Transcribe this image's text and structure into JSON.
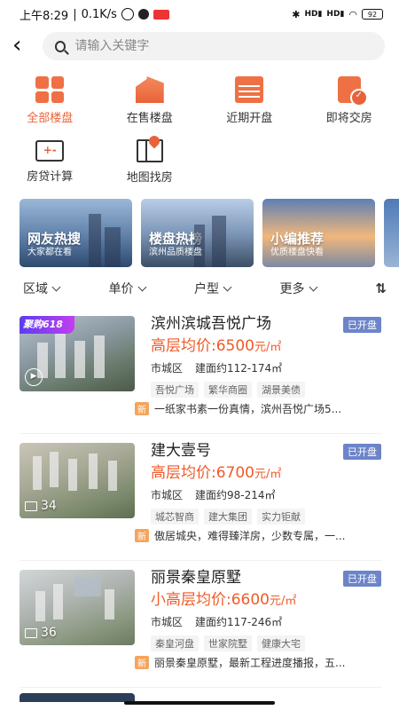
{
  "statusbar": {
    "time": "上午8:29",
    "net_speed": "0.1K/s",
    "separator": "|",
    "signal1": "HD",
    "signal2": "HD",
    "battery": "92"
  },
  "search": {
    "placeholder": "请输入关键字"
  },
  "entries": [
    {
      "label": "全部楼盘",
      "icon": "grid-icon",
      "active": true
    },
    {
      "label": "在售楼盘",
      "icon": "building-icon",
      "active": false
    },
    {
      "label": "近期开盘",
      "icon": "calendar-icon",
      "active": false
    },
    {
      "label": "即将交房",
      "icon": "handover-icon",
      "active": false
    },
    {
      "label": "房贷计算",
      "icon": "calculator-icon",
      "active": false
    },
    {
      "label": "地图找房",
      "icon": "map-icon",
      "active": false
    }
  ],
  "calc_symbol": "+-",
  "banners": [
    {
      "title": "网友热搜",
      "subtitle": "大家都在看"
    },
    {
      "title": "楼盘热榜",
      "subtitle": "滨州品质楼盘"
    },
    {
      "title": "小编推荐",
      "subtitle": "优质楼盘快看"
    }
  ],
  "filters": {
    "area": "区域",
    "price": "单价",
    "layout": "户型",
    "more": "更多",
    "sort": "⇅"
  },
  "listings": [
    {
      "promo": "聚购618",
      "badge": "",
      "name": "滨州滨城吾悦广场",
      "status": "已开盘",
      "price_prefix": "高层均价:",
      "price": "6500",
      "unit": "元/㎡",
      "district": "市城区",
      "area": "建面约112-174㎡",
      "tags": [
        "吾悦广场",
        "繁华商圈",
        "湖景美债"
      ],
      "news_tag": "新",
      "news": "一纸家书素一份真情，滨州吾悦广场5..."
    },
    {
      "promo": "",
      "badge": "34",
      "name": "建大壹号",
      "status": "已开盘",
      "price_prefix": "高层均价:",
      "price": "6700",
      "unit": "元/㎡",
      "district": "市城区",
      "area": "建面约98-214㎡",
      "tags": [
        "城芯智商",
        "建大集团",
        "实力钜献"
      ],
      "news_tag": "新",
      "news": "傲居城央，难得臻洋房，少数专属，一..."
    },
    {
      "promo": "",
      "badge": "36",
      "name": "丽景秦皇原墅",
      "status": "已开盘",
      "price_prefix": "小高层均价:",
      "price": "6600",
      "unit": "元/㎡",
      "district": "市城区",
      "area": "建面约117-246㎡",
      "tags": [
        "秦皇河盘",
        "世家院墅",
        "健康大宅"
      ],
      "news_tag": "新",
      "news": "丽景秦皇原墅，最新工程进度播报，五..."
    }
  ]
}
